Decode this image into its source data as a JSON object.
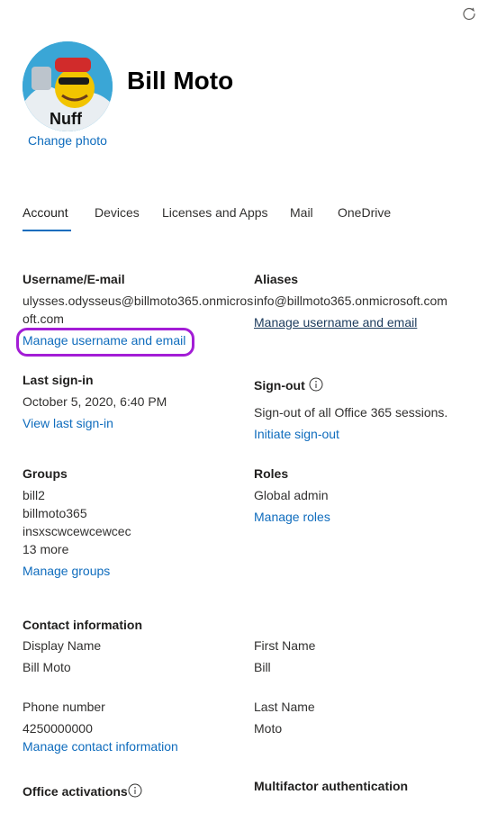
{
  "user": {
    "name": "Bill Moto",
    "change_photo": "Change photo"
  },
  "tabs": [
    "Account",
    "Devices",
    "Licenses and Apps",
    "Mail",
    "OneDrive"
  ],
  "username_section": {
    "heading": "Username/E-mail",
    "value_line1": "ulysses.odysseus@billmoto365.onmicros",
    "value_line2": "oft.com",
    "manage_link": "Manage username and email"
  },
  "aliases_section": {
    "heading": "Aliases",
    "value": "info@billmoto365.onmicrosoft.com",
    "manage_link": "Manage username and email"
  },
  "last_signin": {
    "heading": "Last sign-in",
    "value": "October 5, 2020, 6:40 PM",
    "link": "View last sign-in"
  },
  "signout": {
    "heading": "Sign-out",
    "description": "Sign-out of all Office 365 sessions.",
    "link": "Initiate sign-out"
  },
  "groups": {
    "heading": "Groups",
    "items": [
      "bill2",
      "billmoto365",
      "insxscwcewcewcec"
    ],
    "more": "13 more",
    "link": "Manage groups"
  },
  "roles": {
    "heading": "Roles",
    "value": "Global admin",
    "link": "Manage roles"
  },
  "contact": {
    "heading": "Contact information",
    "display_name_label": "Display Name",
    "display_name_value": "Bill Moto",
    "first_name_label": "First Name",
    "first_name_value": "Bill",
    "phone_label": "Phone number",
    "phone_value": "4250000000",
    "last_name_label": "Last Name",
    "last_name_value": "Moto",
    "manage_link": "Manage contact information"
  },
  "office_activations": {
    "heading": "Office activations"
  },
  "mfa": {
    "heading": "Multifactor authentication"
  },
  "avatar_text": "Nuff",
  "colors": {
    "accent": "#0f6cbd",
    "highlight": "#a31dd6"
  }
}
